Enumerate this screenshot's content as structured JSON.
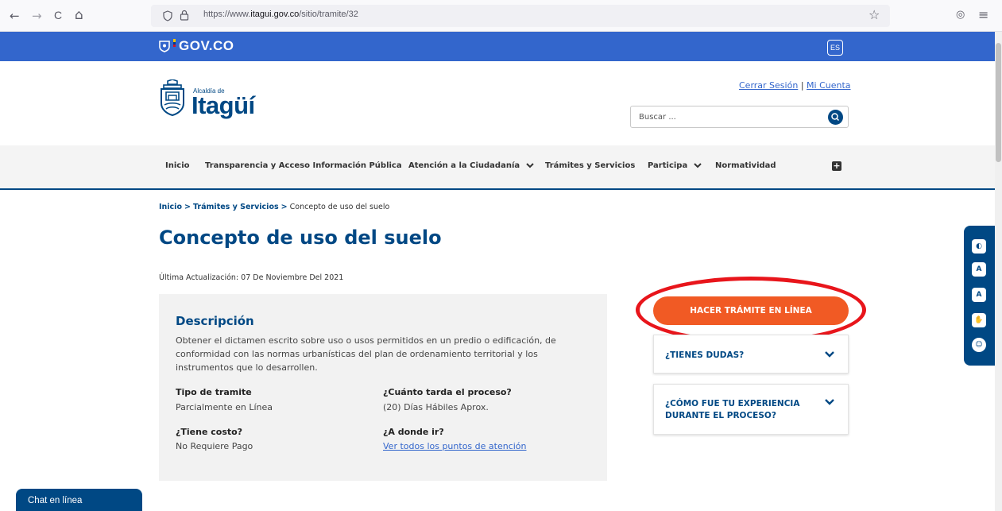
{
  "browser": {
    "back": "←",
    "forward": "→",
    "reload": "C",
    "home": "⌂",
    "url_prefix": "https://www.",
    "url_domain": "itagui.gov.co",
    "url_path": "/sitio/tramite/32",
    "star": "☆",
    "pocket": "◎",
    "menu": "≡"
  },
  "gov_bar": {
    "logo": "GOV.CO",
    "lang": "ES",
    "color": "#3366cc"
  },
  "header": {
    "logo_small": "Alcaldía de",
    "logo_big": "Itagüí",
    "logout": "Cerrar Sesión",
    "separator": "|",
    "account": "Mi Cuenta",
    "search_placeholder": "Buscar ..."
  },
  "menu": {
    "items": [
      {
        "label": "Inicio"
      },
      {
        "label": "Transparencia y Acceso Información Pública"
      },
      {
        "label": "Atención a la Ciudadanía"
      },
      {
        "label": "Trámites y Servicios"
      },
      {
        "label": "Participa"
      },
      {
        "label": "Normatividad"
      }
    ],
    "plus": "+"
  },
  "breadcrumb": {
    "home": "Inicio",
    "sep1": ">",
    "section": "Trámites y Servicios",
    "sep2": ">",
    "current": "Concepto de uso del suelo"
  },
  "page": {
    "title": "Concepto de uso del suelo",
    "updated": "Última Actualización: 07 De Noviembre Del 2021"
  },
  "description": {
    "title": "Descripción",
    "text": "Obtener el dictamen escrito sobre uso o usos permitidos en un predio o edificación, de conformidad con las normas urbanísticas del plan de ordenamiento territorial y los instrumentos que lo desarrollen.",
    "fields": {
      "type_label": "Tipo de tramite",
      "type_value": "Parcialmente en Línea",
      "time_label": "¿Cuánto tarda el proceso?",
      "time_value": "(20) Días Hábiles Aprox.",
      "cost_label": "¿Tiene costo?",
      "cost_value": "No Requiere Pago",
      "where_label": "¿A donde ir?",
      "where_link": "Ver todos los puntos de atención"
    }
  },
  "sidebar": {
    "cta": "HACER TRÁMITE EN LÍNEA",
    "cta_color": "#f15a24",
    "doubts": "¿TIENES DUDAS?",
    "experience_line1": "¿CÓMO FUE TU EXPERIENCIA",
    "experience_line2": "DURANTE EL PROCESO?"
  },
  "accessibility": {
    "contrast": "◐",
    "font_down": "A",
    "font_up": "A",
    "sign": "✋",
    "emoji": "☺"
  },
  "chat": {
    "label": "Chat en línea"
  },
  "colors": {
    "primary": "#004884",
    "highlight": "#e8151b"
  }
}
